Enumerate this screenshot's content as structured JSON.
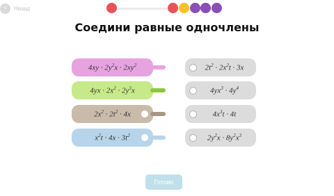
{
  "nav": {
    "back_label": "Назад",
    "back_icon": "chevron-left-icon"
  },
  "progress": {
    "dots": [
      {
        "color": "#e8525a",
        "state": "done"
      },
      {
        "color": "#e8525a",
        "state": "done"
      },
      {
        "color": "#f4c22b",
        "state": "done"
      },
      {
        "color": "#8a4fb5",
        "state": "done"
      },
      {
        "color": "#8a4fb5",
        "state": "done"
      },
      {
        "color": "#8a4fb5",
        "state": "done"
      }
    ]
  },
  "title": "Соедини равные одночлены",
  "left_cards": [
    {
      "parts": [
        "4xy · 2y",
        "2",
        "x · 2xy",
        "2",
        ""
      ],
      "color": "#e7a3e0",
      "connector": "#e7a3e0",
      "plug": true
    },
    {
      "parts": [
        "4yx · 2x",
        "2",
        " · 2y",
        "3",
        "x"
      ],
      "color": "#c6e98a",
      "connector": "#8cc63e",
      "plug": true
    },
    {
      "parts": [
        "2x",
        "2",
        " · 2t",
        "2",
        " · 4x"
      ],
      "color": "#c9bbaa",
      "connector": "#a89684",
      "plug": false
    },
    {
      "parts": [
        "x",
        "2",
        "t · 4x · 3t",
        "2",
        ""
      ],
      "color": "#b6d5ea",
      "connector": "#b6d5ea",
      "plug": false
    }
  ],
  "right_cards": [
    {
      "parts": [
        "2t",
        "2",
        " · 2x",
        "2",
        "t · 3x"
      ]
    },
    {
      "parts": [
        "4yx",
        "3",
        " · 4y",
        "4",
        ""
      ]
    },
    {
      "parts": [
        "4x",
        "3",
        "t · 4t",
        "",
        ""
      ]
    },
    {
      "parts": [
        "2y",
        "2",
        "x · 8y",
        "2",
        "x",
        "3",
        ""
      ]
    }
  ],
  "colors": {
    "right_card_bg": "#dcdcdc",
    "done_button": "#bfe0ea"
  },
  "done_button": {
    "label": "Готово"
  }
}
